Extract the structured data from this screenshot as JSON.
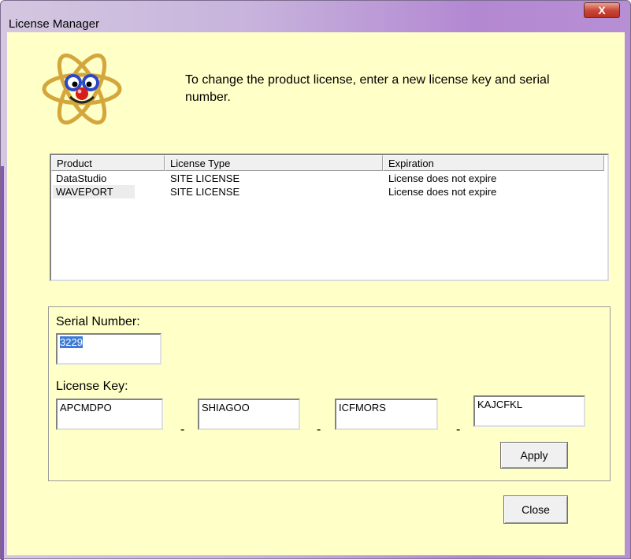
{
  "window": {
    "title": "License Manager",
    "close_glyph": "X",
    "accent": "#b388d2",
    "client_bg": "#ffffc8"
  },
  "logo": {
    "icon": "atom-smiley-icon"
  },
  "intro_text": "To change the product license, enter a new license key and serial number.",
  "licenses": {
    "columns": [
      "Product",
      "License Type",
      "Expiration"
    ],
    "rows": [
      {
        "product": "DataStudio",
        "type": "SITE LICENSE",
        "expiration": "License does not expire"
      },
      {
        "product": "WAVEPORT",
        "type": "SITE LICENSE",
        "expiration": "License does not expire"
      }
    ]
  },
  "serial": {
    "label": "Serial Number:",
    "value": "3229"
  },
  "license_key": {
    "label": "License Key:",
    "parts": [
      "APCMDPO",
      "SHIAGOO",
      "ICFMORS",
      "KAJCFKL"
    ],
    "separator": "-"
  },
  "buttons": {
    "apply": "Apply",
    "close": "Close"
  }
}
